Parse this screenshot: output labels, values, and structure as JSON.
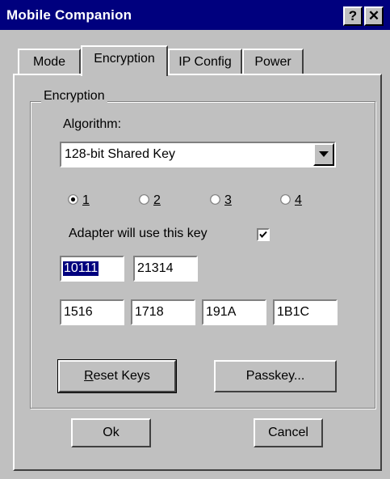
{
  "window": {
    "title": "Mobile Companion",
    "help_button": "?",
    "close_button": "✕"
  },
  "tabs": [
    {
      "label": "Mode",
      "active": false
    },
    {
      "label": "Encryption",
      "active": true
    },
    {
      "label": "IP Config",
      "active": false
    },
    {
      "label": "Power",
      "active": false
    }
  ],
  "encryption": {
    "group_label": "Encryption",
    "algorithm_label": "Algorithm:",
    "algorithm_value": "128-bit Shared Key",
    "key_options": [
      {
        "label": "1",
        "selected": true
      },
      {
        "label": "2",
        "selected": false
      },
      {
        "label": "3",
        "selected": false
      },
      {
        "label": "4",
        "selected": false
      }
    ],
    "adapter_label": "Adapter will use this key",
    "adapter_checked": true,
    "key_fields_row1": [
      "10111",
      "21314"
    ],
    "key_fields_row2": [
      "1516",
      "1718",
      "191A",
      "1B1C"
    ],
    "reset_keys_accel": "R",
    "reset_keys_rest": "eset Keys",
    "passkey_label": "Passkey..."
  },
  "footer": {
    "ok_label": "Ok",
    "cancel_label": "Cancel"
  },
  "colors": {
    "titlebar": "#00007e",
    "face": "#c0c0c0",
    "selection": "#00007e"
  }
}
